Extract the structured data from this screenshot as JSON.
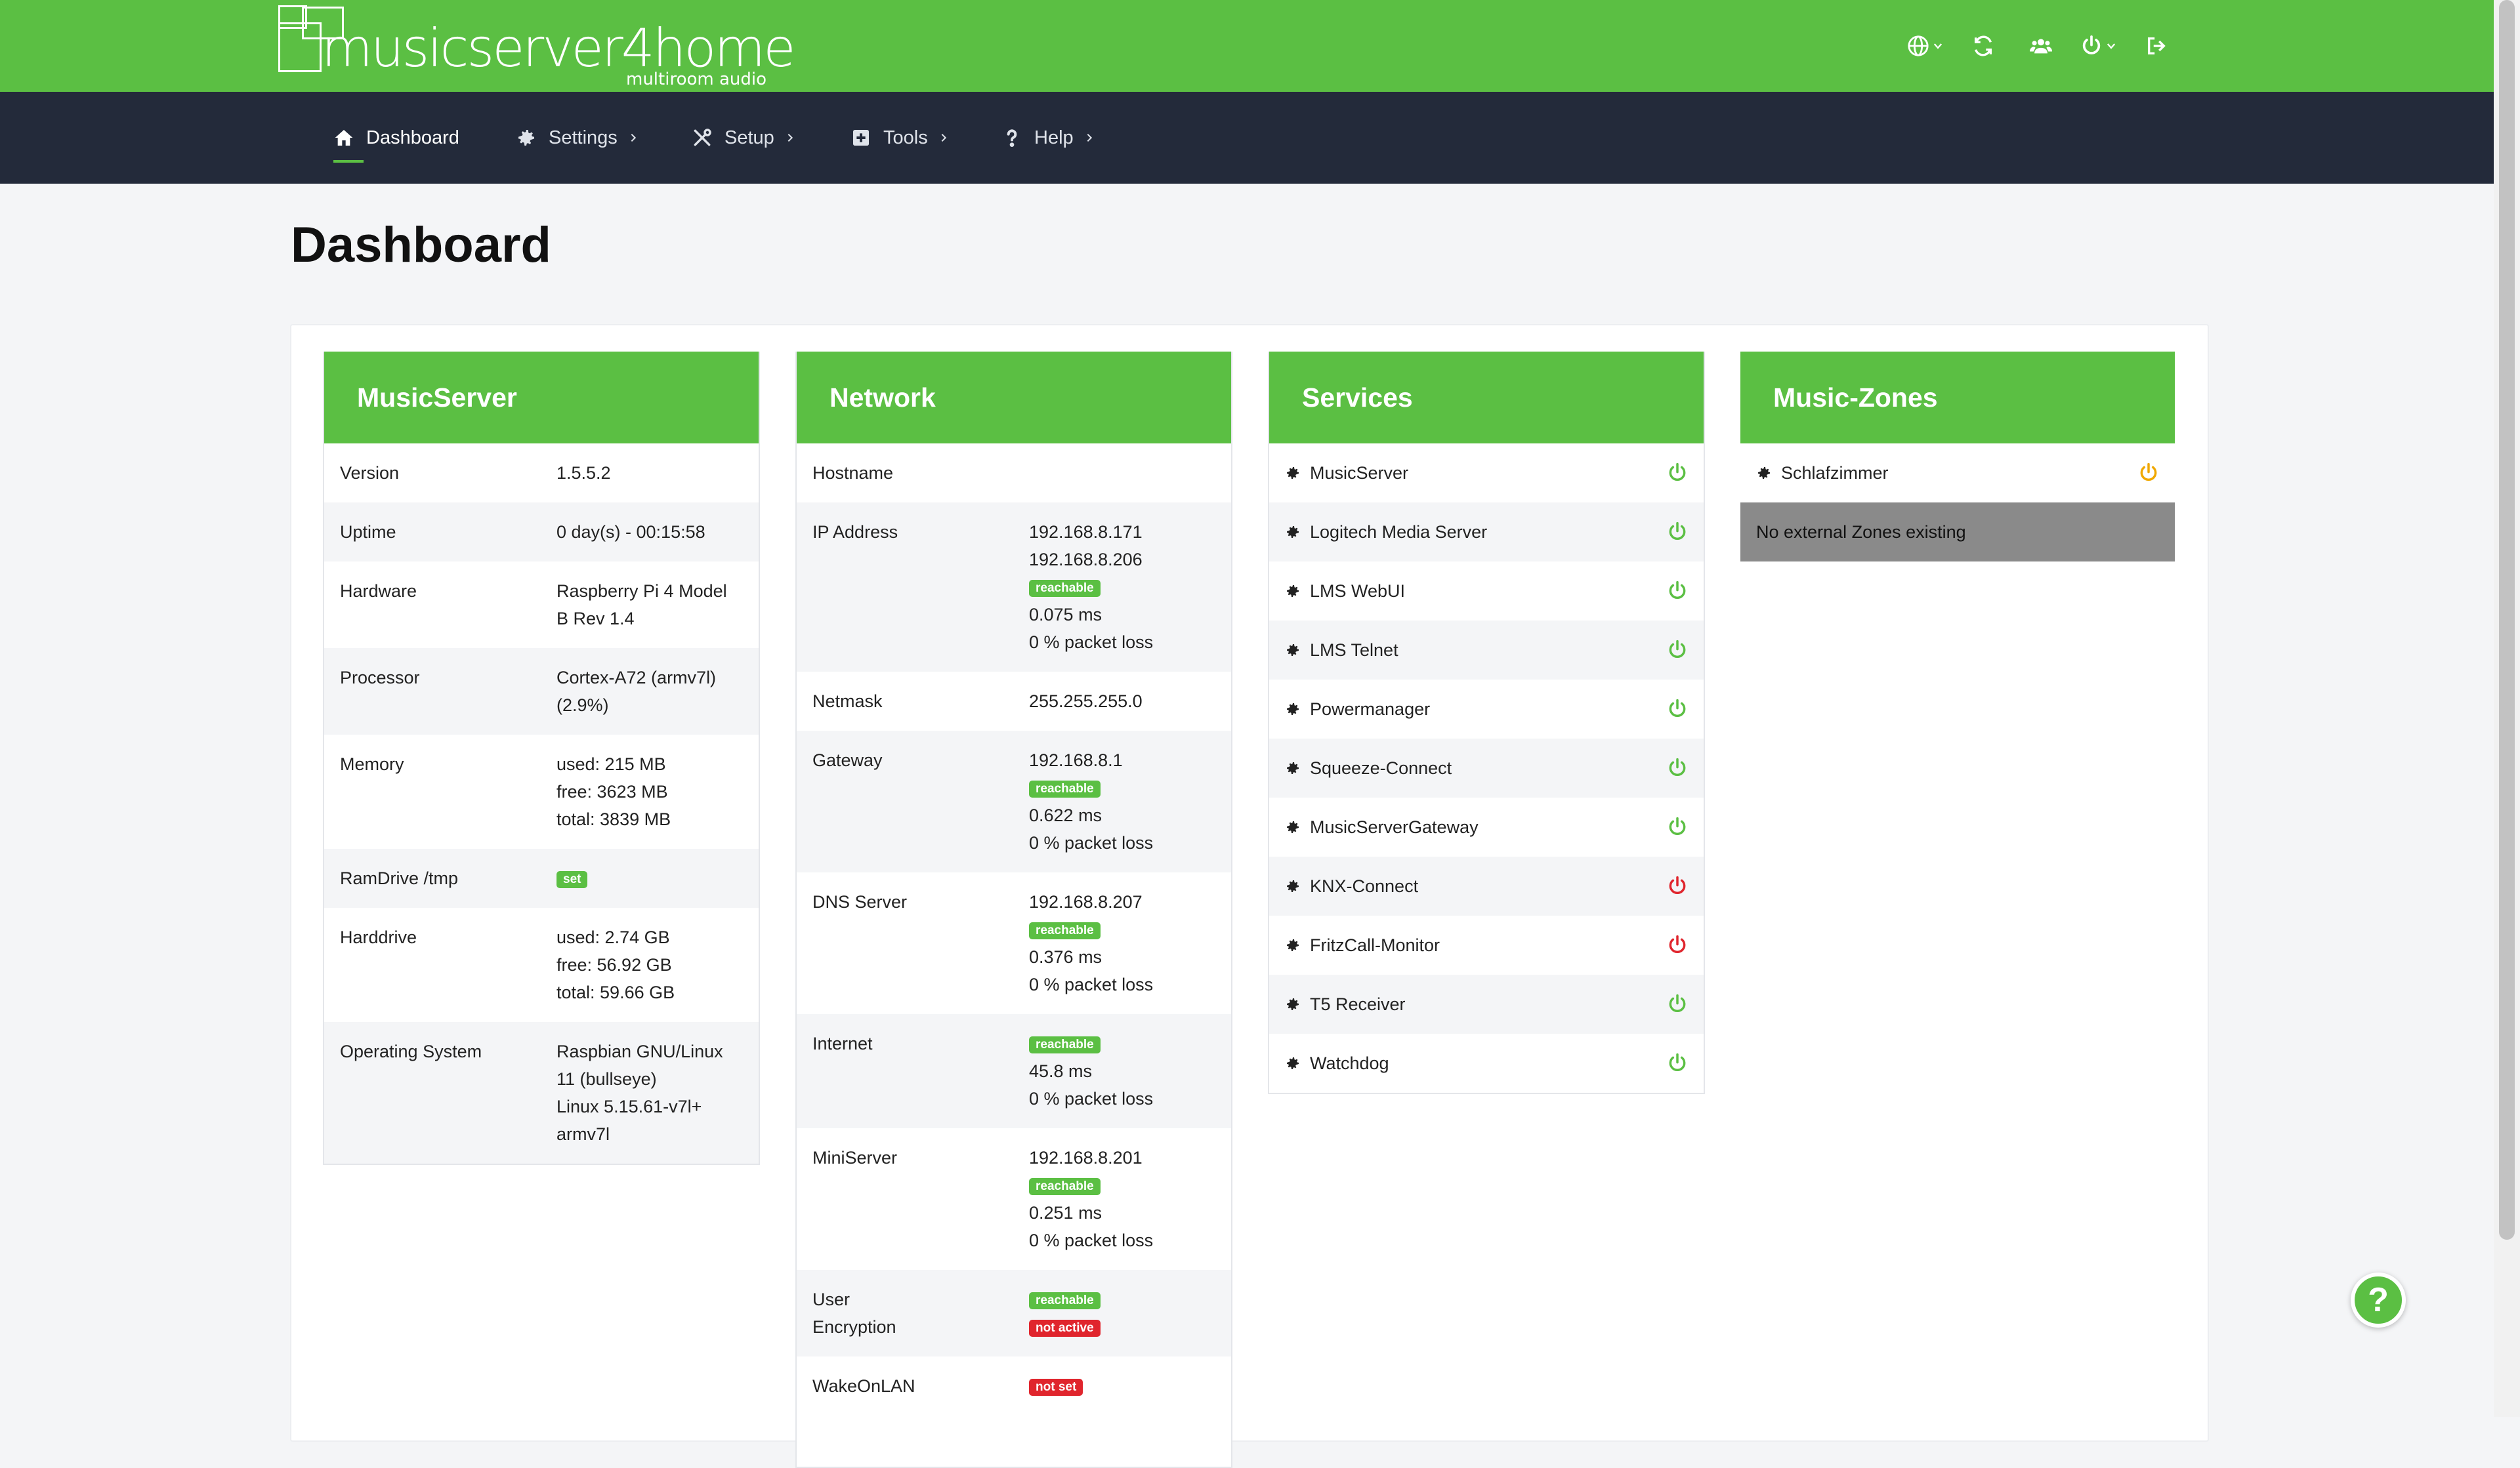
{
  "brand": {
    "name": "musicserver4home",
    "subtitle": "multiroom audio"
  },
  "colors": {
    "accent": "#5bbf43",
    "nav_bg": "#232a3a",
    "ok": "#5bbf43",
    "error": "#e0252d",
    "warn": "#f0a800"
  },
  "topbar_icons": [
    "globe-icon",
    "refresh-icon",
    "users-icon",
    "power-icon",
    "logout-icon"
  ],
  "nav": [
    {
      "label": "Dashboard",
      "icon": "home-icon",
      "active": true
    },
    {
      "label": "Settings",
      "icon": "gear-icon"
    },
    {
      "label": "Setup",
      "icon": "tools-icon"
    },
    {
      "label": "Tools",
      "icon": "plus-square-icon"
    },
    {
      "label": "Help",
      "icon": "question-icon"
    }
  ],
  "page_title": "Dashboard",
  "musicserver": {
    "title": "MusicServer",
    "rows": [
      {
        "key": "Version",
        "lines": [
          "1.5.5.2"
        ]
      },
      {
        "key": "Uptime",
        "lines": [
          "0 day(s) - 00:15:58"
        ]
      },
      {
        "key": "Hardware",
        "lines": [
          "Raspberry Pi 4 Model",
          "B Rev 1.4"
        ]
      },
      {
        "key": "Processor",
        "lines": [
          "Cortex-A72 (armv7l)",
          "(2.9%)"
        ]
      },
      {
        "key": "Memory",
        "lines": [
          "used: 215 MB",
          "free: 3623 MB",
          "total: 3839 MB"
        ]
      },
      {
        "key": "RamDrive /tmp",
        "badge": "set"
      },
      {
        "key": "Harddrive",
        "lines": [
          "used: 2.74 GB",
          "free: 56.92 GB",
          "total: 59.66 GB"
        ]
      },
      {
        "key": "Operating System",
        "lines": [
          "Raspbian GNU/Linux",
          "11 (bullseye)",
          "Linux 5.15.61-v7l+",
          "armv7l"
        ]
      }
    ]
  },
  "network": {
    "title": "Network",
    "rows": [
      {
        "key": "Hostname",
        "lines": [
          ""
        ]
      },
      {
        "key": "IP Address",
        "lines": [
          "192.168.8.171",
          "192.168.8.206"
        ],
        "badge": "reachable",
        "after": [
          "0.075 ms",
          "0 % packet loss"
        ]
      },
      {
        "key": "Netmask",
        "lines": [
          "255.255.255.0"
        ]
      },
      {
        "key": "Gateway",
        "lines": [
          "192.168.8.1"
        ],
        "badge": "reachable",
        "after": [
          "0.622 ms",
          "0 % packet loss"
        ]
      },
      {
        "key": "DNS Server",
        "lines": [
          "192.168.8.207"
        ],
        "badge": "reachable",
        "after": [
          "0.376 ms",
          "0 % packet loss"
        ]
      },
      {
        "key": "Internet",
        "lines": [],
        "badge": "reachable",
        "after": [
          "45.8 ms",
          "0 % packet loss"
        ]
      },
      {
        "key": "MiniServer",
        "lines": [
          "192.168.8.201"
        ],
        "badge": "reachable",
        "after": [
          "0.251 ms",
          "0 % packet loss"
        ]
      },
      {
        "key": "User Encryption",
        "key_lines": [
          "User",
          "Encryption"
        ],
        "badges": [
          {
            "text": "reachable",
            "color": "green"
          },
          {
            "text": "not active",
            "color": "red"
          }
        ]
      },
      {
        "key": "WakeOnLAN",
        "badges": [
          {
            "text": "not set",
            "color": "red"
          }
        ]
      }
    ]
  },
  "services": {
    "title": "Services",
    "items": [
      {
        "label": "MusicServer",
        "status": "ok"
      },
      {
        "label": "Logitech Media Server",
        "status": "ok"
      },
      {
        "label": "LMS WebUI",
        "status": "ok"
      },
      {
        "label": "LMS Telnet",
        "status": "ok"
      },
      {
        "label": "Powermanager",
        "status": "ok"
      },
      {
        "label": "Squeeze-Connect",
        "status": "ok"
      },
      {
        "label": "MusicServerGateway",
        "status": "ok"
      },
      {
        "label": "KNX-Connect",
        "status": "error"
      },
      {
        "label": "FritzCall-Monitor",
        "status": "error"
      },
      {
        "label": "T5 Receiver",
        "status": "ok"
      },
      {
        "label": "Watchdog",
        "status": "ok"
      }
    ]
  },
  "zones": {
    "title": "Music-Zones",
    "items": [
      {
        "label": "Schlafzimmer",
        "status": "warn"
      }
    ],
    "empty_text": "No external Zones existing"
  },
  "help_button": "?"
}
